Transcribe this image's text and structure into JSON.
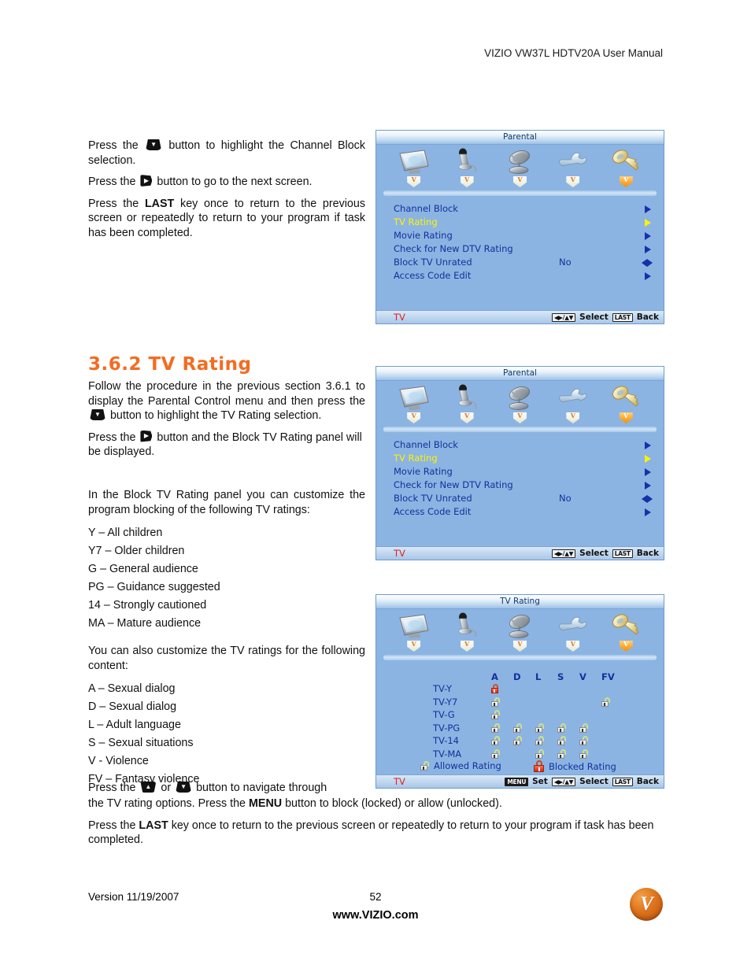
{
  "document": {
    "header": "VIZIO VW37L HDTV20A User Manual",
    "footer": {
      "version": "Version 11/19/2007",
      "page_number": "52",
      "url": "www.VIZIO.com",
      "logo_letter": "V"
    }
  },
  "left_column": {
    "intro_block": {
      "line1_pre": "Press the",
      "line1_post": "button to highlight the Channel Block selection.",
      "line2_pre": "Press the",
      "line2_post": "button to go to the next screen.",
      "line3_pre": "Press the",
      "line3_bold": "LAST",
      "line3_post": "key once to return to the previous screen or repeatedly to return to your program if task has been completed."
    },
    "section": {
      "heading": "3.6.2 TV Rating",
      "p1_pre": "Follow the procedure in the previous section 3.6.1 to display the Parental Control menu and then press the",
      "p1_post": "button to highlight the TV Rating selection.",
      "p2_pre": "Press the",
      "p2_post": "button and the Block TV Rating panel will be displayed.",
      "p3": "In the Block TV Rating panel you can customize the program blocking of the following TV ratings:",
      "tv_ratings": [
        "Y – All children",
        "Y7 – Older children",
        "G – General audience",
        "PG – Guidance suggested",
        "14 – Strongly cautioned",
        "MA – Mature audience"
      ],
      "p4": "You can also customize the TV ratings for the following content:",
      "content_ratings": [
        "A – Sexual dialog",
        "D – Sexual dialog",
        "L – Adult language",
        "S – Sexual situations",
        "V - Violence",
        "FV – Fantasy violence"
      ],
      "p5_pre": "Press the",
      "p5_or": "or",
      "p5_mid": "button to navigate through the TV rating options.  Press the",
      "p5_bold": "MENU",
      "p5_post": "button to block (locked) or allow (unlocked).",
      "p6_pre": "Press the",
      "p6_bold": "LAST",
      "p6_post": "key once to return to the previous screen or repeatedly to return to your program if task has been completed."
    }
  },
  "osd_common": {
    "icon_tabs": [
      {
        "name": "tv-picture-icon",
        "badge": "V",
        "active": false
      },
      {
        "name": "microphone-audio-icon",
        "badge": "V",
        "active": false
      },
      {
        "name": "satellite-dish-tuner-icon",
        "badge": "V",
        "active": false
      },
      {
        "name": "wrench-setup-icon",
        "badge": "V",
        "active": false
      },
      {
        "name": "key-parental-icon",
        "badge": "V",
        "active": true
      }
    ],
    "footer_source": "TV",
    "footer_select": "Select",
    "footer_back": "Back",
    "footer_set": "Set",
    "key_menu": "MENU",
    "key_last": "LAST"
  },
  "parental_panel": {
    "title": "Parental",
    "rows": [
      {
        "label": "Channel Block",
        "value": "",
        "arrow": "right",
        "selected": false
      },
      {
        "label": "TV Rating",
        "value": "",
        "arrow": "right",
        "selected": true
      },
      {
        "label": "Movie Rating",
        "value": "",
        "arrow": "right",
        "selected": false
      },
      {
        "label": "Check for New DTV Rating",
        "value": "",
        "arrow": "right",
        "selected": false
      },
      {
        "label": "Block TV Unrated",
        "value": "No",
        "arrow": "left-right",
        "selected": false
      },
      {
        "label": "Access Code Edit",
        "value": "",
        "arrow": "right",
        "selected": false
      }
    ]
  },
  "tv_rating_panel": {
    "title": "TV Rating",
    "columns": [
      "A",
      "D",
      "L",
      "S",
      "V",
      "FV"
    ],
    "rows": [
      {
        "label": "TV-Y",
        "locks": {
          "A": "blocked"
        }
      },
      {
        "label": "TV-Y7",
        "locks": {
          "A": "allowed",
          "FV": "allowed"
        }
      },
      {
        "label": "TV-G",
        "locks": {
          "A": "allowed"
        }
      },
      {
        "label": "TV-PG",
        "locks": {
          "A": "allowed",
          "D": "allowed",
          "L": "allowed",
          "S": "allowed",
          "V": "allowed"
        }
      },
      {
        "label": "TV-14",
        "locks": {
          "A": "allowed",
          "D": "allowed",
          "L": "allowed",
          "S": "allowed",
          "V": "allowed"
        }
      },
      {
        "label": "TV-MA",
        "locks": {
          "A": "allowed",
          "L": "allowed",
          "S": "allowed",
          "V": "allowed"
        }
      }
    ],
    "legend_allowed": "Allowed Rating",
    "legend_blocked": "Blocked Rating"
  },
  "colors": {
    "accent_orange": "#F26C22",
    "osd_background": "#8BB4E2",
    "osd_text_blue": "#14309B",
    "osd_selected_yellow": "#FFF200",
    "osd_source_red": "#E02020",
    "blocked_red": "#D42A13"
  }
}
